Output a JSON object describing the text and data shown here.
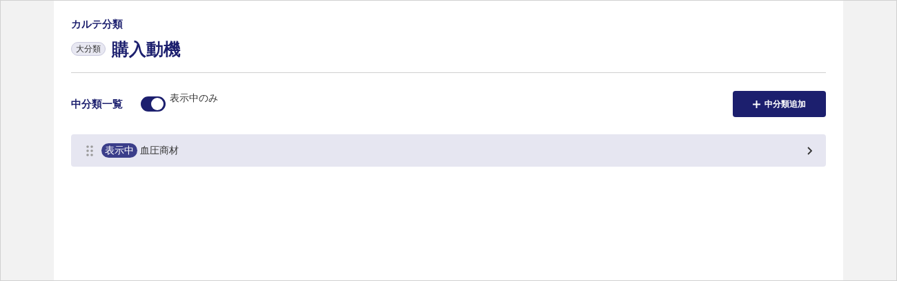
{
  "header": {
    "section_title": "カルテ分類",
    "category_badge": "大分類",
    "category_name": "購入動機"
  },
  "list_header": {
    "title": "中分類一覧",
    "filter_toggle": {
      "label": "表示中のみ",
      "on": true
    },
    "add_button": "中分類追加"
  },
  "items": [
    {
      "status": "表示中",
      "name": "血圧商材"
    }
  ]
}
